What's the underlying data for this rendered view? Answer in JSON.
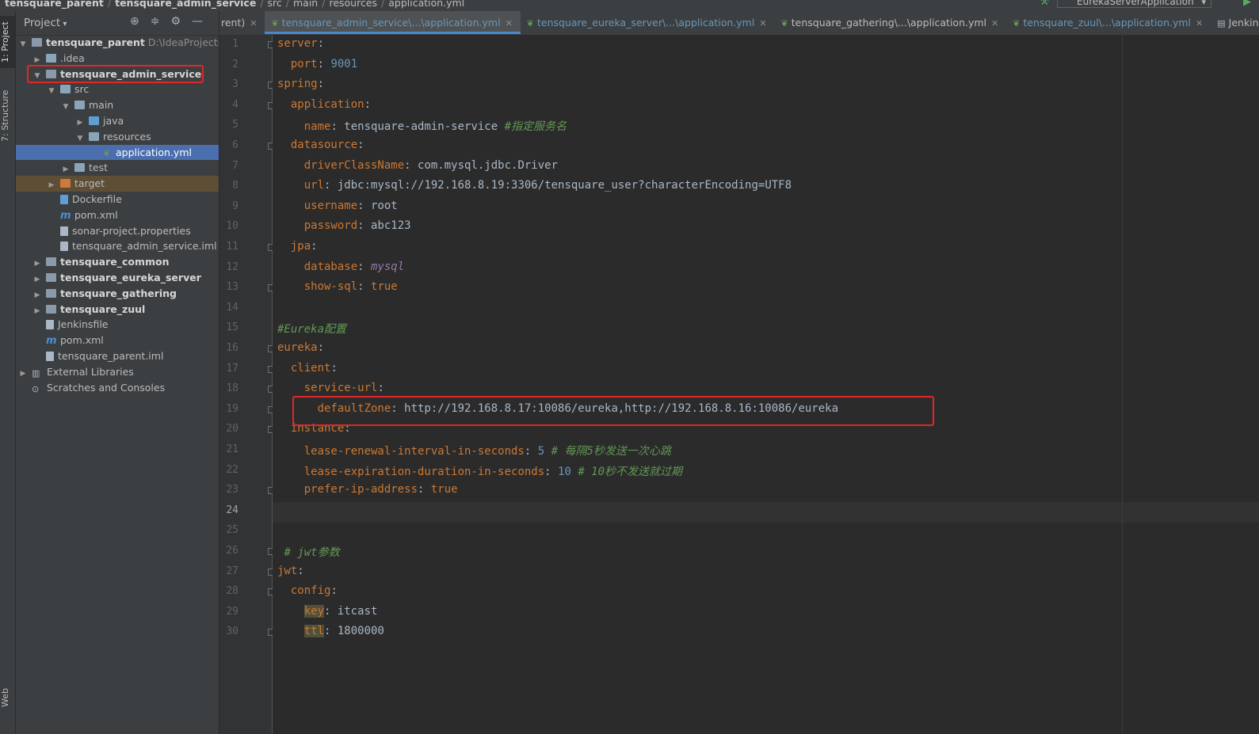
{
  "breadcrumb": [
    "tensquare_parent",
    "tensquare_admin_service",
    "src",
    "main",
    "resources",
    "application.yml"
  ],
  "run_config": "EurekaServerApplication",
  "side_tabs": {
    "project": "1: Project",
    "structure": "7: Structure",
    "web": "Web"
  },
  "project_panel": {
    "title": "Project",
    "tree": [
      {
        "label": "tensquare_parent",
        "extra": "D:\\IdeaProjects\\ter"
      },
      {
        "label": ".idea"
      },
      {
        "label": "tensquare_admin_service"
      },
      {
        "label": "src"
      },
      {
        "label": "main"
      },
      {
        "label": "java"
      },
      {
        "label": "resources"
      },
      {
        "label": "application.yml"
      },
      {
        "label": "test"
      },
      {
        "label": "target"
      },
      {
        "label": "Dockerfile"
      },
      {
        "label": "pom.xml"
      },
      {
        "label": "sonar-project.properties"
      },
      {
        "label": "tensquare_admin_service.iml"
      },
      {
        "label": "tensquare_common"
      },
      {
        "label": "tensquare_eureka_server"
      },
      {
        "label": "tensquare_gathering"
      },
      {
        "label": "tensquare_zuul"
      },
      {
        "label": "Jenkinsfile"
      },
      {
        "label": "pom.xml"
      },
      {
        "label": "tensquare_parent.iml"
      },
      {
        "label": "External Libraries"
      },
      {
        "label": "Scratches and Consoles"
      }
    ]
  },
  "tabs": [
    {
      "label": "rent)"
    },
    {
      "label": "tensquare_admin_service\\...\\application.yml"
    },
    {
      "label": "tensquare_eureka_server\\...\\application.yml"
    },
    {
      "label": "tensquare_gathering\\...\\application.yml"
    },
    {
      "label": "tensquare_zuul\\...\\application.yml"
    },
    {
      "label": "Jenkinsfile"
    }
  ],
  "editor": {
    "line_numbers": [
      "1",
      "2",
      "3",
      "4",
      "5",
      "6",
      "7",
      "8",
      "9",
      "10",
      "11",
      "12",
      "13",
      "14",
      "15",
      "16",
      "17",
      "18",
      "19",
      "20",
      "21",
      "22",
      "23",
      "24",
      "25",
      "26",
      "27",
      "28",
      "29",
      "30"
    ],
    "current_line": "24",
    "lines": {
      "l1": "server",
      "l2k": "port",
      "l2v": "9001",
      "l3": "spring",
      "l4": "application",
      "l5k": "name",
      "l5v": "tensquare-admin-service ",
      "l5c": "#指定服务名",
      "l6": "datasource",
      "l7k": "driverClassName",
      "l7v": "com.mysql.jdbc.Driver",
      "l8k": "url",
      "l8v": "jdbc:mysql://192.168.8.19:3306/tensquare_user?characterEncoding=UTF8",
      "l9k": "username",
      "l9v": "root",
      "l10k": "password",
      "l10v": "abc123",
      "l11": "jpa",
      "l12k": "database",
      "l12v": "mysql",
      "l13k": "show-sql",
      "l13v": "true",
      "l15": "#Eureka配置",
      "l16": "eureka",
      "l17": "client",
      "l18": "service-url",
      "l19k": "defaultZone",
      "l19v": "http://192.168.8.17:10086/eureka,http://192.168.8.16:10086/eureka",
      "l20": "instance",
      "l21k": "lease-renewal-interval-in-seconds",
      "l21v": "5",
      "l21c": "# 每隔5秒发送一次心跳",
      "l22k": "lease-expiration-duration-in-seconds",
      "l22v": "10",
      "l22c": "# 10秒不发送就过期",
      "l23k": "prefer-ip-address",
      "l23v": "true",
      "l26": "# jwt参数",
      "l27": "jwt",
      "l28": "config",
      "l29k": "key",
      "l29v": "itcast",
      "l30k": "ttl",
      "l30v": "1800000"
    }
  },
  "colors": {
    "highlight_box": "#e0272a",
    "selection": "#4b6eaf",
    "key": "#cc7832",
    "number": "#6897bb",
    "comment": "#629755"
  }
}
